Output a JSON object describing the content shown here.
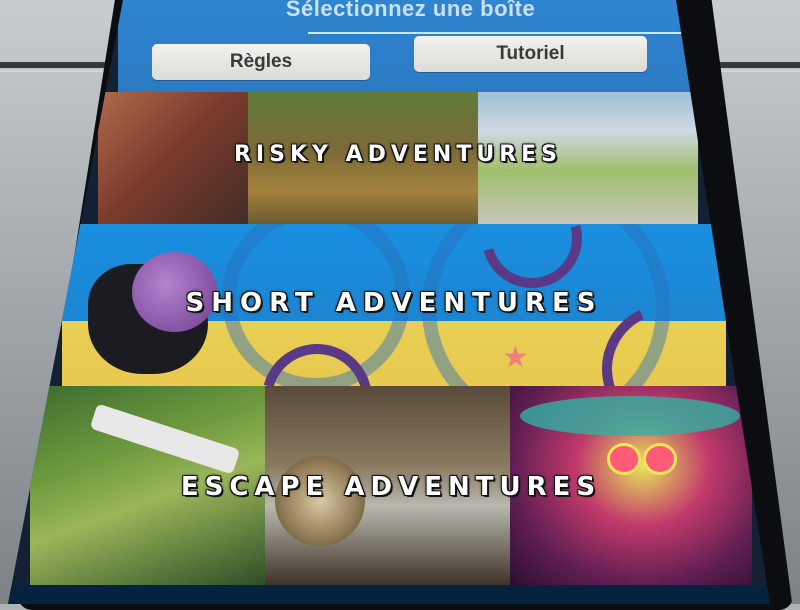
{
  "header": {
    "title": "Sélectionnez une boîte",
    "rules_label": "Règles",
    "tutorial_label": "Tutoriel"
  },
  "banners": [
    {
      "label": "RISKY ADVENTURES"
    },
    {
      "label": "SHORT ADVENTURES"
    },
    {
      "label": "ESCAPE ADVENTURES"
    }
  ],
  "colors": {
    "header_blue": "#2f85cf",
    "button_bg": "#f3f2ee",
    "short_sky": "#1a8ee0",
    "short_sand": "#e7cf55"
  }
}
